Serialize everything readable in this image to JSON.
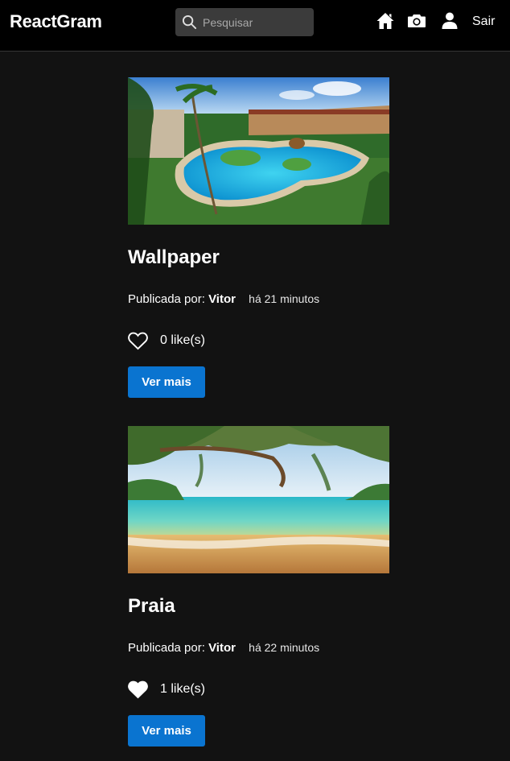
{
  "app": {
    "brand": "ReactGram"
  },
  "search": {
    "placeholder": "Pesquisar",
    "value": ""
  },
  "nav": {
    "icons": [
      "home-icon",
      "camera-icon",
      "user-icon"
    ],
    "logout_label": "Sair"
  },
  "posts": [
    {
      "title": "Wallpaper",
      "published_by_label": "Publicada por:",
      "author": "Vitor",
      "time": "há 21 minutos",
      "likes_label": "0 like(s)",
      "liked": false,
      "button_label": "Ver mais"
    },
    {
      "title": "Praia",
      "published_by_label": "Publicada por:",
      "author": "Vitor",
      "time": "há 22 minutos",
      "likes_label": "1 like(s)",
      "liked": true,
      "button_label": "Ver mais"
    }
  ],
  "colors": {
    "background": "#121212",
    "navbar": "#000000",
    "search_bg": "#3b3b3b",
    "accent": "#0a74d0"
  }
}
